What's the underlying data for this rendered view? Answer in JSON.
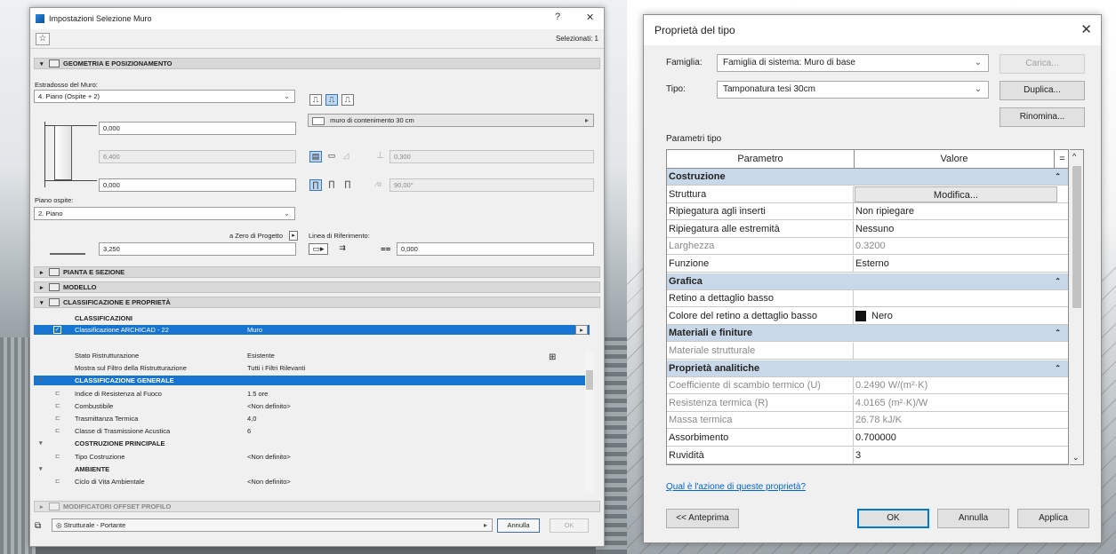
{
  "archicad": {
    "title": "Impostazioni Selezione Muro",
    "title_help": "?",
    "title_close": "✕",
    "selected": "Selezionati: 1",
    "geometry": {
      "section": "GEOMETRIA E POSIZIONAMENTO",
      "top_label": "Estradosso del Muro:",
      "top_value": "4. Piano (Ospite + 2)",
      "val_top": "0,000",
      "val_height": "6,400",
      "val_bottom": "0,000",
      "host_label": "Piano ospite:",
      "host_value": "2. Piano",
      "zero_label": "a Zero di Progetto",
      "val_zero": "3,250",
      "composite": "muro di contenimento 30 cm",
      "thickness": "0,300",
      "angle": "90,00°",
      "ref_label": "Linea di Riferimento:",
      "ref_value": "0,000"
    },
    "sections": {
      "plan": "PIANTA E SEZIONE",
      "model": "MODELLO",
      "classif": "CLASSIFICAZIONE E PROPRIETÀ",
      "offset": "MODIFICATORI OFFSET PROFILO"
    },
    "classifications": {
      "header": "CLASSIFICAZIONI",
      "item_label": "Classificazione ARCHICAD - 22",
      "item_value": "Muro"
    },
    "properties": [
      {
        "label": "Stato Ristrutturazione",
        "value": "Esistente",
        "kind": "plain"
      },
      {
        "label": "Mostra sul Filtro della Ristrutturazione",
        "value": "Tutti i Filtri Rilevanti",
        "kind": "plain"
      },
      {
        "label": "CLASSIFICAZIONE GENERALE",
        "value": "",
        "kind": "blue"
      },
      {
        "label": "Indice di Resistenza al Fuoco",
        "value": "1.5 ore",
        "kind": "item"
      },
      {
        "label": "Combustibile",
        "value": "<Non definito>",
        "kind": "item"
      },
      {
        "label": "Trasmittanza Termica",
        "value": "4,0",
        "kind": "item"
      },
      {
        "label": "Classe di Trasmissione Acustica",
        "value": "6",
        "kind": "item"
      },
      {
        "label": "COSTRUZIONE PRINCIPALE",
        "value": "",
        "kind": "head"
      },
      {
        "label": "Tipo Costruzione",
        "value": "<Non definito>",
        "kind": "item"
      },
      {
        "label": "AMBIENTE",
        "value": "",
        "kind": "head"
      },
      {
        "label": "Ciclo di Vita Ambientale",
        "value": "<Non definito>",
        "kind": "item"
      }
    ],
    "structure": "Strutturale - Portante",
    "cancel": "Annulla",
    "ok": "OK"
  },
  "revit": {
    "title": "Proprietà del tipo",
    "close": "✕",
    "family_label": "Famiglia:",
    "family_value": "Famiglia di sistema: Muro di base",
    "type_label": "Tipo:",
    "type_value": "Tamponatura tesi 30cm",
    "load": "Carica...",
    "duplicate": "Duplica...",
    "rename": "Rinomina...",
    "params_title": "Parametri tipo",
    "col_param": "Parametro",
    "col_value": "Valore",
    "col_eq": "=",
    "rows": [
      {
        "p": "Costruzione",
        "v": "",
        "kind": "cat"
      },
      {
        "p": "Struttura",
        "v": "Modifica...",
        "kind": "button"
      },
      {
        "p": "Ripiegatura agli inserti",
        "v": "Non ripiegare",
        "kind": "normal"
      },
      {
        "p": "Ripiegatura alle estremità",
        "v": "Nessuno",
        "kind": "normal"
      },
      {
        "p": "Larghezza",
        "v": "0.3200",
        "kind": "gray"
      },
      {
        "p": "Funzione",
        "v": "Esterno",
        "kind": "normal"
      },
      {
        "p": "Grafica",
        "v": "",
        "kind": "cat"
      },
      {
        "p": "Retino a dettaglio basso",
        "v": "",
        "kind": "normal"
      },
      {
        "p": "Colore del retino a dettaglio basso",
        "v": "Nero",
        "kind": "swatch"
      },
      {
        "p": "Materiali e finiture",
        "v": "",
        "kind": "cat"
      },
      {
        "p": "Materiale strutturale",
        "v": "",
        "kind": "gray"
      },
      {
        "p": "Proprietà analitiche",
        "v": "",
        "kind": "cat"
      },
      {
        "p": "Coefficiente di scambio termico (U)",
        "v": "0.2490 W/(m²·K)",
        "kind": "gray"
      },
      {
        "p": "Resistenza termica (R)",
        "v": "4.0165 (m²·K)/W",
        "kind": "gray"
      },
      {
        "p": "Massa termica",
        "v": "26.78 kJ/K",
        "kind": "gray"
      },
      {
        "p": "Assorbimento",
        "v": "0.700000",
        "kind": "normal"
      },
      {
        "p": "Ruvidità",
        "v": "3",
        "kind": "normal"
      }
    ],
    "help_link": "Qual è l'azione di queste proprietà?",
    "preview": "<< Anteprima",
    "ok": "OK",
    "cancel": "Annulla",
    "apply": "Applica"
  },
  "colors": {
    "selection_blue": "#1874d1",
    "category_blue": "#c8d8e8",
    "link_blue": "#0066cc"
  }
}
